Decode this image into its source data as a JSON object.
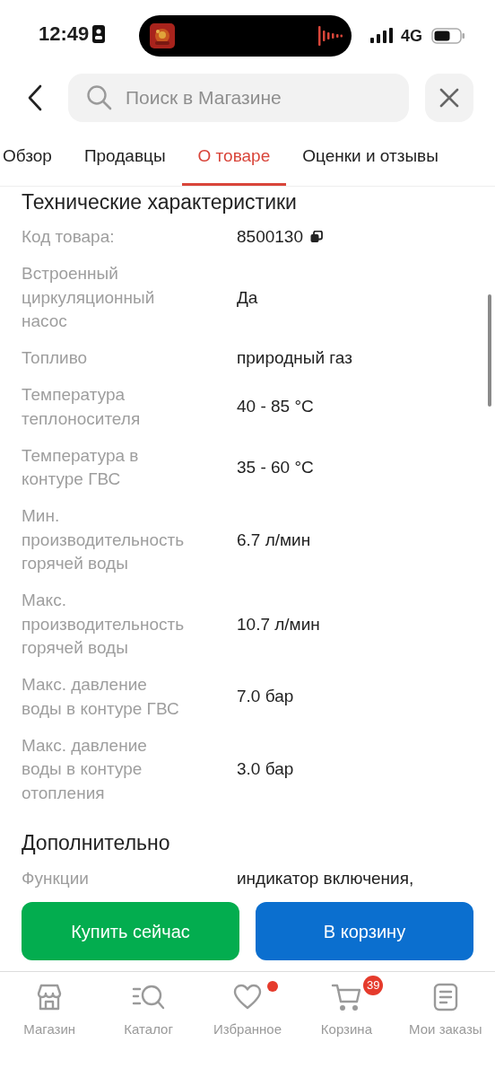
{
  "status_bar": {
    "time": "12:49",
    "network": "4G"
  },
  "search": {
    "placeholder": "Поиск в Магазине"
  },
  "tabs": [
    {
      "label": "Обзор",
      "selected": false
    },
    {
      "label": "Продавцы",
      "selected": false
    },
    {
      "label": "О товаре",
      "selected": true
    },
    {
      "label": "Оценки и отзывы",
      "selected": false
    }
  ],
  "sections": [
    {
      "title": "Технические характеристики",
      "rows": [
        {
          "label": "Код товара:",
          "value": "8500130",
          "copyable": true
        },
        {
          "label": "Встроенный\nциркуляционный\nнасос",
          "value": "Да"
        },
        {
          "label": "Топливо",
          "value": "природный газ"
        },
        {
          "label": "Температура\nтеплоносителя",
          "value": "40 - 85 °C"
        },
        {
          "label": "Температура в\nконтуре ГВС",
          "value": "35 - 60 °C"
        },
        {
          "label": "Мин.\nпроизводительность\nгорячей воды",
          "value": "6.7 л/мин"
        },
        {
          "label": "Макс.\nпроизводительность\nгорячей воды",
          "value": "10.7 л/мин"
        },
        {
          "label": "Макс. давление\nводы в контуре ГВС",
          "value": "7.0 бар"
        },
        {
          "label": "Макс. давление\nводы в контуре\nотопления",
          "value": "3.0 бар"
        }
      ]
    },
    {
      "title": "Дополнительно",
      "rows": [
        {
          "label": "Функции",
          "value": "индикатор включения,"
        }
      ]
    }
  ],
  "actions": [
    {
      "label": "Купить сейчас",
      "kind": "buy"
    },
    {
      "label": "В корзину",
      "kind": "cart"
    }
  ],
  "bottom_nav": [
    {
      "label": "Магазин",
      "kind": "store"
    },
    {
      "label": "Каталог",
      "kind": "catalog"
    },
    {
      "label": "Избранное",
      "kind": "favorites",
      "dot": true
    },
    {
      "label": "Корзина",
      "kind": "cart",
      "badge": "39"
    },
    {
      "label": "Мои заказы",
      "kind": "orders"
    }
  ]
}
